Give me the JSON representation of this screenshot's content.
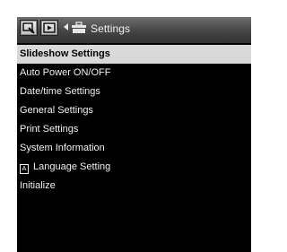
{
  "header": {
    "title": "Settings",
    "tabs": [
      {
        "icon": "playback-settings-icon"
      },
      {
        "icon": "slideshow-play-icon"
      }
    ],
    "back_icon": "back-arrow-icon",
    "section_icon": "toolbox-icon"
  },
  "menu": {
    "items": [
      {
        "label": "Slideshow Settings",
        "selected": true
      },
      {
        "label": "Auto Power ON/OFF"
      },
      {
        "label": "Date/time Settings"
      },
      {
        "label": "General Settings"
      },
      {
        "label": "Print Settings"
      },
      {
        "label": "System Information"
      },
      {
        "label": "Language Setting",
        "icon": "language-icon",
        "icon_glyph": "A"
      },
      {
        "label": "Initialize"
      }
    ]
  },
  "colors": {
    "background": "#000000",
    "selected_bg": "#d9d9d9",
    "text": "#f0f0f0"
  }
}
